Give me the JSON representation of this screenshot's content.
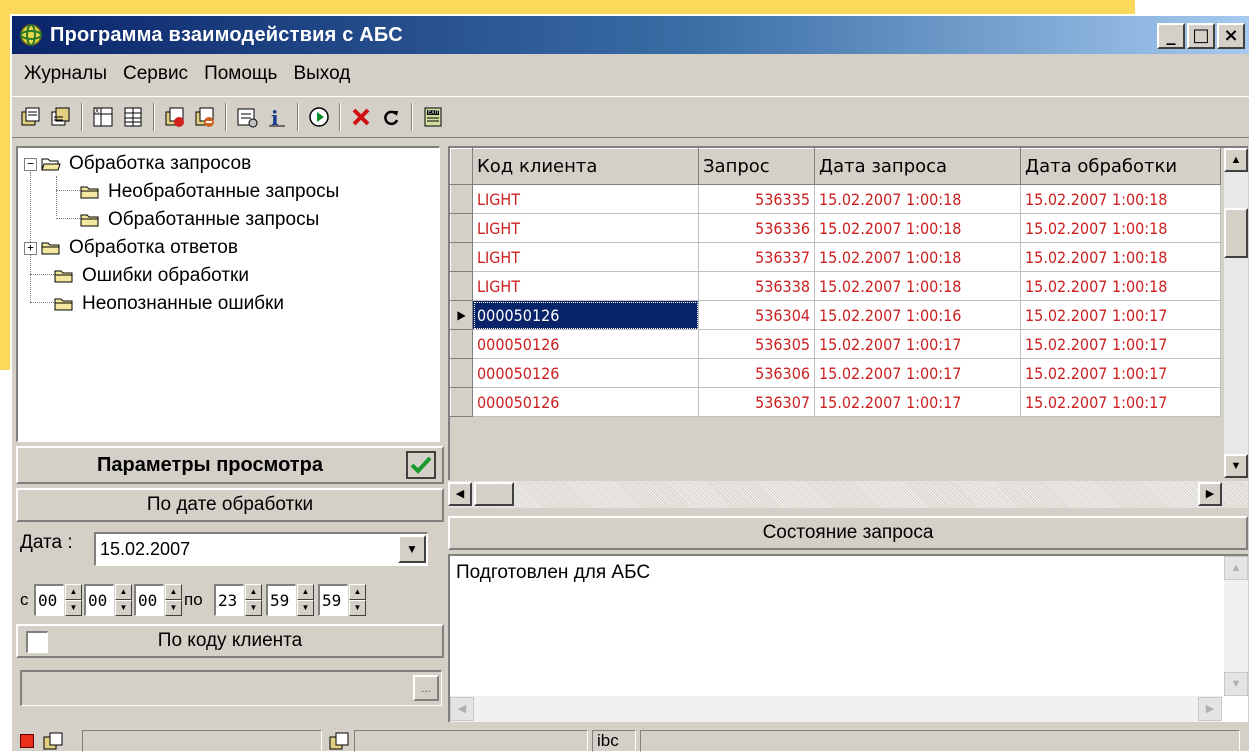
{
  "window": {
    "title": "Программа взаимодействия с АБС"
  },
  "window_buttons": {
    "minimize": "_",
    "maximize": "□",
    "close": "×"
  },
  "menu": [
    "Журналы",
    "Сервис",
    "Помощь",
    "Выход"
  ],
  "toolbar_icons": [
    "journal-icon",
    "journal-alt-icon",
    "export-icon",
    "table-icon",
    "journal-error-icon",
    "journal-stop-icon",
    "settings-icon",
    "info-icon",
    "run-icon",
    "delete-icon",
    "refresh-icon",
    "exit-icon"
  ],
  "tree": {
    "expanders": {
      "collapse": "−",
      "expand": "+"
    },
    "nodes": [
      {
        "label": "Обработка запросов",
        "level": 0,
        "expander": "minus",
        "open": true
      },
      {
        "label": "Необработанные запросы",
        "level": 1
      },
      {
        "label": "Обработанные запросы",
        "level": 1
      },
      {
        "label": "Обработка ответов",
        "level": 0,
        "expander": "plus"
      },
      {
        "label": "Ошибки обработки",
        "level": 0
      },
      {
        "label": "Неопознанные ошибки",
        "level": 0
      }
    ]
  },
  "params": {
    "title": "Параметры просмотра",
    "by_date_label": "По дате обработки",
    "date_label": "Дата :",
    "date_value": "15.02.2007",
    "from_label": "с",
    "to_label": "по",
    "time_from": [
      "00",
      "00",
      "00"
    ],
    "time_to": [
      "23",
      "59",
      "59"
    ],
    "by_client_label": "По коду клиента",
    "client_checked": false,
    "client_value": "",
    "ellipsis": "..."
  },
  "grid": {
    "columns": [
      "Код клиента",
      "Запрос",
      "Дата запроса",
      "Дата обработки"
    ],
    "rows": [
      [
        "LIGHT",
        "536335",
        "15.02.2007 1:00:18",
        "15.02.2007 1:00:18"
      ],
      [
        "LIGHT",
        "536336",
        "15.02.2007 1:00:18",
        "15.02.2007 1:00:18"
      ],
      [
        "LIGHT",
        "536337",
        "15.02.2007 1:00:18",
        "15.02.2007 1:00:18"
      ],
      [
        "LIGHT",
        "536338",
        "15.02.2007 1:00:18",
        "15.02.2007 1:00:18"
      ],
      [
        "000050126",
        "536304",
        "15.02.2007 1:00:16",
        "15.02.2007 1:00:17"
      ],
      [
        "000050126",
        "536305",
        "15.02.2007 1:00:17",
        "15.02.2007 1:00:17"
      ],
      [
        "000050126",
        "536306",
        "15.02.2007 1:00:17",
        "15.02.2007 1:00:17"
      ],
      [
        "000050126",
        "536307",
        "15.02.2007 1:00:17",
        "15.02.2007 1:00:17"
      ]
    ],
    "selected_row": 4,
    "text_color": "#cc2020",
    "selection_color": "#0a246a"
  },
  "state": {
    "title": "Состояние запроса",
    "text": "Подготовлен для АБС"
  },
  "statusbar": {
    "text": "ibc"
  }
}
